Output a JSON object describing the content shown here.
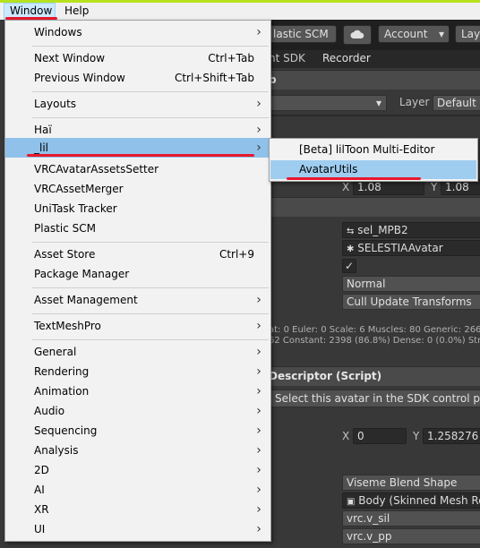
{
  "menubar": {
    "window_label": "Window",
    "help_label": "Help"
  },
  "background": {
    "plastic_scm": "lastic SCM",
    "account": "Account",
    "account_arrow": "▾",
    "layout": "Lay",
    "tab_sdk": "nt SDK",
    "tab_recorder": "Recorder",
    "header_b": "b",
    "layer_label": "Layer",
    "layer_value": "Default",
    "x_label": "X",
    "x_value": "1.08",
    "y_label": "Y",
    "y_value": "1.08",
    "mpb_field": "sel_MPB2",
    "avatar_field": "SELESTIAAvatar",
    "checkmark": "✓",
    "normal": "Normal",
    "cull": "Cull Update Transforms",
    "stats_line1": "at: 0 Euler: 0 Scale: 6 Muscles: 80 Generic: 2664",
    "stats_line2": "62 Constant: 2398 (86.8%) Dense: 0 (0.0%) Stre",
    "descriptor_header": "Descriptor (Script)",
    "select_avatar": "Select this avatar in the SDK control pane",
    "x2_label": "X",
    "x2_value": "0",
    "y2_label": "Y",
    "y2_value": "1.258276",
    "viseme": "Viseme Blend Shape",
    "body": "Body (Skinned Mesh Ren",
    "v_sil": "vrc.v_sil",
    "v_pp": "vrc.v_pp"
  },
  "menu": {
    "items": [
      {
        "label": "Windows",
        "shortcut": "",
        "arrow": "›"
      },
      {
        "label": "Next Window",
        "shortcut": "Ctrl+Tab",
        "arrow": ""
      },
      {
        "label": "Previous Window",
        "shortcut": "Ctrl+Shift+Tab",
        "arrow": ""
      },
      {
        "label": "Layouts",
        "shortcut": "",
        "arrow": "›"
      },
      {
        "label": "Haï",
        "shortcut": "",
        "arrow": "›"
      },
      {
        "label": "_lil",
        "shortcut": "",
        "arrow": "›"
      },
      {
        "label": "VRCAvatarAssetsSetter",
        "shortcut": "",
        "arrow": ""
      },
      {
        "label": "VRCAssetMerger",
        "shortcut": "",
        "arrow": ""
      },
      {
        "label": "UniTask Tracker",
        "shortcut": "",
        "arrow": ""
      },
      {
        "label": "Plastic SCM",
        "shortcut": "",
        "arrow": ""
      },
      {
        "label": "Asset Store",
        "shortcut": "Ctrl+9",
        "arrow": ""
      },
      {
        "label": "Package Manager",
        "shortcut": "",
        "arrow": ""
      },
      {
        "label": "Asset Management",
        "shortcut": "",
        "arrow": "›"
      },
      {
        "label": "TextMeshPro",
        "shortcut": "",
        "arrow": "›"
      },
      {
        "label": "General",
        "shortcut": "",
        "arrow": "›"
      },
      {
        "label": "Rendering",
        "shortcut": "",
        "arrow": "›"
      },
      {
        "label": "Animation",
        "shortcut": "",
        "arrow": "›"
      },
      {
        "label": "Audio",
        "shortcut": "",
        "arrow": "›"
      },
      {
        "label": "Sequencing",
        "shortcut": "",
        "arrow": "›"
      },
      {
        "label": "Analysis",
        "shortcut": "",
        "arrow": "›"
      },
      {
        "label": "2D",
        "shortcut": "",
        "arrow": "›"
      },
      {
        "label": "AI",
        "shortcut": "",
        "arrow": "›"
      },
      {
        "label": "XR",
        "shortcut": "",
        "arrow": "›"
      },
      {
        "label": "UI",
        "shortcut": "",
        "arrow": "›"
      }
    ]
  },
  "submenu": {
    "items": [
      {
        "label": "[Beta] lilToon Multi-Editor"
      },
      {
        "label": "AvatarUtils"
      }
    ]
  },
  "colors": {
    "highlight": "#8fc1ea",
    "annotation_red": "#e8192c",
    "top_strip": "#b6e21d"
  }
}
